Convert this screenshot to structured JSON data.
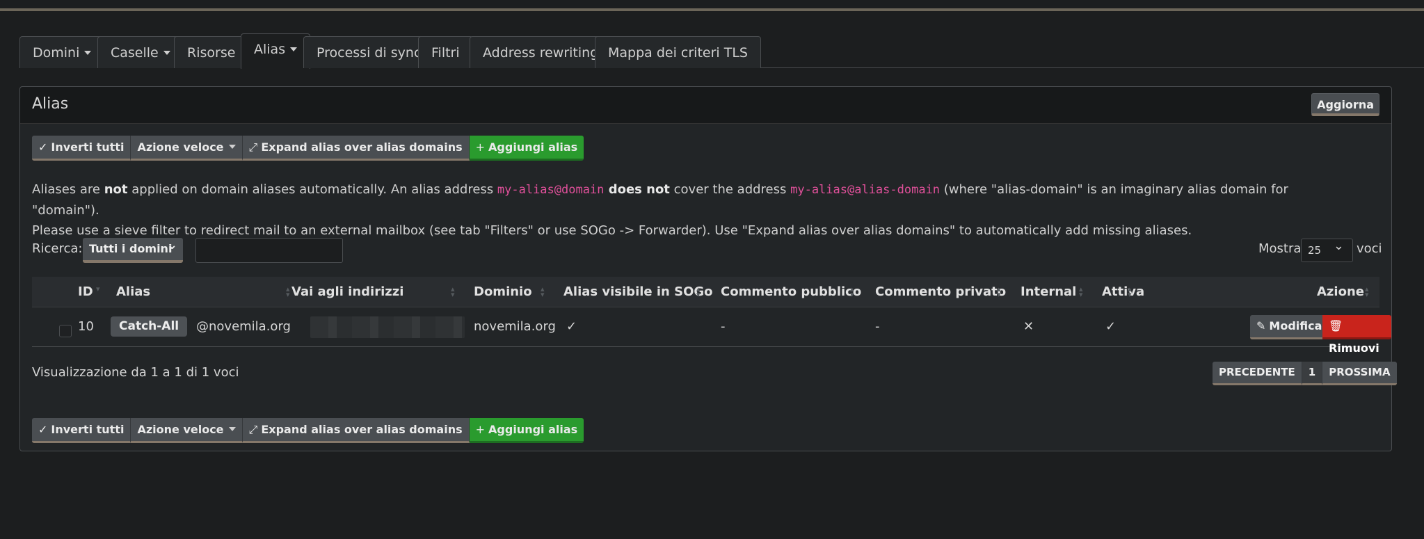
{
  "tabs": [
    {
      "label": "Domini",
      "caret": true
    },
    {
      "label": "Caselle",
      "caret": true
    },
    {
      "label": "Risorse",
      "caret": false
    },
    {
      "label": "Alias",
      "caret": true,
      "active": true
    },
    {
      "label": "Processi di sync",
      "caret": false
    },
    {
      "label": "Filtri",
      "caret": false
    },
    {
      "label": "Address rewriting",
      "caret": false
    },
    {
      "label": "Mappa dei criteri TLS",
      "caret": false
    }
  ],
  "panel": {
    "title": "Alias",
    "refresh_label": "Aggiorna"
  },
  "toolbar": {
    "invert_label": "Inverti tutti",
    "quick_action_label": "Azione veloce",
    "expand_label": "Expand alias over alias domains",
    "add_label": "Aggiungi alias"
  },
  "info": {
    "line1_a": "Aliases are ",
    "line1_b": "not",
    "line1_c": " applied on domain aliases automatically. An alias address ",
    "line1_code1": "my-alias@domain",
    "line1_d": " does not",
    "line1_e": " cover the address ",
    "line1_code2": "my-alias@alias-domain",
    "line1_f": " (where \"alias-domain\" is an imaginary alias domain for \"domain\").",
    "line2": "Please use a sieve filter to redirect mail to an external mailbox (see tab \"Filters\" or use SOGo -> Forwarder). Use \"Expand alias over alias domains\" to automatically add missing aliases."
  },
  "filter": {
    "search_label": "Ricerca:",
    "domain_select": "Tutti i domini",
    "search_value": "",
    "show_label": "Mostra",
    "page_size": "25",
    "entries_label": "voci"
  },
  "table": {
    "headers": {
      "id": "ID",
      "alias": "Alias",
      "goto": "Vai agli indirizzi",
      "domain": "Dominio",
      "sogo": "Alias visibile in SOGo",
      "public_comment": "Commento pubblico",
      "private_comment": "Commento privato",
      "internal": "Internal",
      "active": "Attiva",
      "action": "Azione"
    },
    "rows": [
      {
        "id": "10",
        "alias_badge": "Catch-All",
        "alias_domain": "@novemila.org",
        "domain": "novemila.org",
        "sogo": "✓",
        "public_comment": "-",
        "private_comment": "-",
        "internal": "✕",
        "active": "✓",
        "edit_label": "Modifica",
        "remove_label": "Rimuovi"
      }
    ]
  },
  "footer": {
    "info": "Visualizzazione da 1 a 1 di 1 voci",
    "prev": "PRECEDENTE",
    "page": "1",
    "next": "PROSSIMA"
  },
  "colors": {
    "accent_green": "#2a9b2e",
    "danger_red": "#c9241c",
    "code_pink": "#e0509a"
  }
}
